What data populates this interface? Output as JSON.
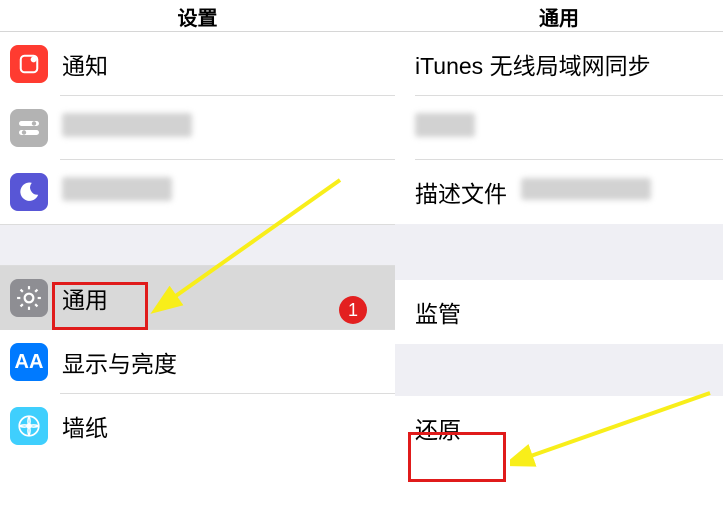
{
  "left": {
    "header": "设置",
    "items": [
      {
        "label": "通知"
      },
      {
        "label": ""
      },
      {
        "label": ""
      },
      {
        "label": "通用"
      },
      {
        "label": "显示与亮度"
      },
      {
        "label": "墙纸"
      }
    ]
  },
  "right": {
    "header": "通用",
    "items": [
      {
        "label": "iTunes 无线局域网同步"
      },
      {
        "label": ""
      },
      {
        "label": "描述文件"
      },
      {
        "label": "监管"
      },
      {
        "label": "还原"
      }
    ]
  },
  "badge": "1"
}
